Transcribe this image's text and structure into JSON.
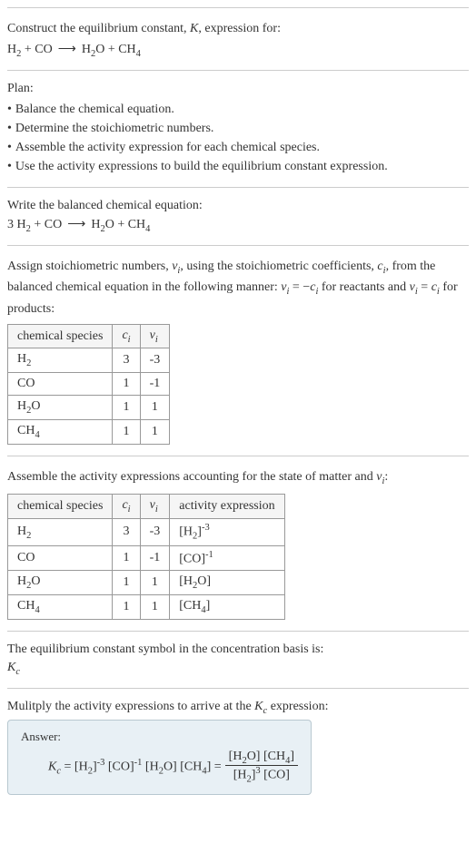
{
  "chart_data": [
    {
      "type": "table",
      "title": "Stoichiometric numbers",
      "columns": [
        "chemical species",
        "c_i",
        "ν_i"
      ],
      "rows": [
        [
          "H₂",
          "3",
          "-3"
        ],
        [
          "CO",
          "1",
          "-1"
        ],
        [
          "H₂O",
          "1",
          "1"
        ],
        [
          "CH₄",
          "1",
          "1"
        ]
      ]
    },
    {
      "type": "table",
      "title": "Activity expressions",
      "columns": [
        "chemical species",
        "c_i",
        "ν_i",
        "activity expression"
      ],
      "rows": [
        [
          "H₂",
          "3",
          "-3",
          "[H₂]⁻³"
        ],
        [
          "CO",
          "1",
          "-1",
          "[CO]⁻¹"
        ],
        [
          "H₂O",
          "1",
          "1",
          "[H₂O]"
        ],
        [
          "CH₄",
          "1",
          "1",
          "[CH₄]"
        ]
      ]
    }
  ],
  "intro": {
    "prompt": "Construct the equilibrium constant, ",
    "k": "K",
    "prompt2": ", expression for:",
    "eq_lhs1": "H",
    "eq_lhs1_sub": "2",
    "plus": " + ",
    "eq_lhs2": "CO",
    "arrow": "⟶",
    "eq_rhs1": "H",
    "eq_rhs1_sub": "2",
    "eq_rhs1b": "O",
    "eq_rhs2": "CH",
    "eq_rhs2_sub": "4"
  },
  "plan": {
    "label": "Plan:",
    "items": [
      "Balance the chemical equation.",
      "Determine the stoichiometric numbers.",
      "Assemble the activity expression for each chemical species.",
      "Use the activity expressions to build the equilibrium constant expression."
    ]
  },
  "balanced": {
    "label": "Write the balanced chemical equation:",
    "coef1": "3 ",
    "h2": "H",
    "sub2": "2",
    "plus": " + ",
    "co": "CO",
    "arrow": "⟶",
    "h2o_h": "H",
    "h2o_o": "O",
    "ch": "CH",
    "sub4": "4"
  },
  "stoich": {
    "text1": "Assign stoichiometric numbers, ",
    "nu": "ν",
    "sub_i": "i",
    "text2": ", using the stoichiometric coefficients, ",
    "c": "c",
    "text3": ", from the balanced chemical equation in the following manner: ",
    "eq1": " = −",
    "text4": " for reactants and ",
    "eq2": " = ",
    "text5": " for products:",
    "headers": {
      "species": "chemical species",
      "ci": "c",
      "nui": "ν"
    },
    "rows": [
      {
        "species_base": "H",
        "species_sub": "2",
        "ci": "3",
        "nui": "-3"
      },
      {
        "species_base": "CO",
        "species_sub": "",
        "ci": "1",
        "nui": "-1"
      },
      {
        "species_base": "H",
        "species_sub": "2",
        "species_suffix": "O",
        "ci": "1",
        "nui": "1"
      },
      {
        "species_base": "CH",
        "species_sub": "4",
        "ci": "1",
        "nui": "1"
      }
    ]
  },
  "activity": {
    "text": "Assemble the activity expressions accounting for the state of matter and ",
    "nu": "ν",
    "sub_i": "i",
    "colon": ":",
    "headers": {
      "species": "chemical species",
      "ci": "c",
      "nui": "ν",
      "expr": "activity expression"
    },
    "rows": [
      {
        "sp_base": "H",
        "sp_sub": "2",
        "ci": "3",
        "nui": "-3",
        "expr_base": "[H",
        "expr_sub": "2",
        "expr_close": "]",
        "expr_sup": "-3"
      },
      {
        "sp_base": "CO",
        "sp_sub": "",
        "ci": "1",
        "nui": "-1",
        "expr_base": "[CO]",
        "expr_sub": "",
        "expr_close": "",
        "expr_sup": "-1"
      },
      {
        "sp_base": "H",
        "sp_sub": "2",
        "sp_suffix": "O",
        "ci": "1",
        "nui": "1",
        "expr_base": "[H",
        "expr_sub": "2",
        "expr_close": "O]",
        "expr_sup": ""
      },
      {
        "sp_base": "CH",
        "sp_sub": "4",
        "ci": "1",
        "nui": "1",
        "expr_base": "[CH",
        "expr_sub": "4",
        "expr_close": "]",
        "expr_sup": ""
      }
    ]
  },
  "symbol": {
    "text": "The equilibrium constant symbol in the concentration basis is:",
    "k": "K",
    "sub": "c"
  },
  "multiply": {
    "text1": "Mulitply the activity expressions to arrive at the ",
    "k": "K",
    "sub": "c",
    "text2": " expression:"
  },
  "answer": {
    "label": "Answer:",
    "k": "K",
    "ksub": "c",
    "eq": " = ",
    "t1_open": "[H",
    "t1_sub": "2",
    "t1_close": "]",
    "t1_sup": "-3",
    "t2": " [CO]",
    "t2_sup": "-1",
    "t3_open": " [H",
    "t3_sub": "2",
    "t3_close": "O]",
    "t4_open": " [CH",
    "t4_sub": "4",
    "t4_close": "] = ",
    "num_1": "[H",
    "num_1sub": "2",
    "num_1close": "O] [CH",
    "num_2sub": "4",
    "num_2close": "]",
    "den_1": "[H",
    "den_1sub": "2",
    "den_1close": "]",
    "den_1sup": "3",
    "den_2": " [CO]"
  }
}
